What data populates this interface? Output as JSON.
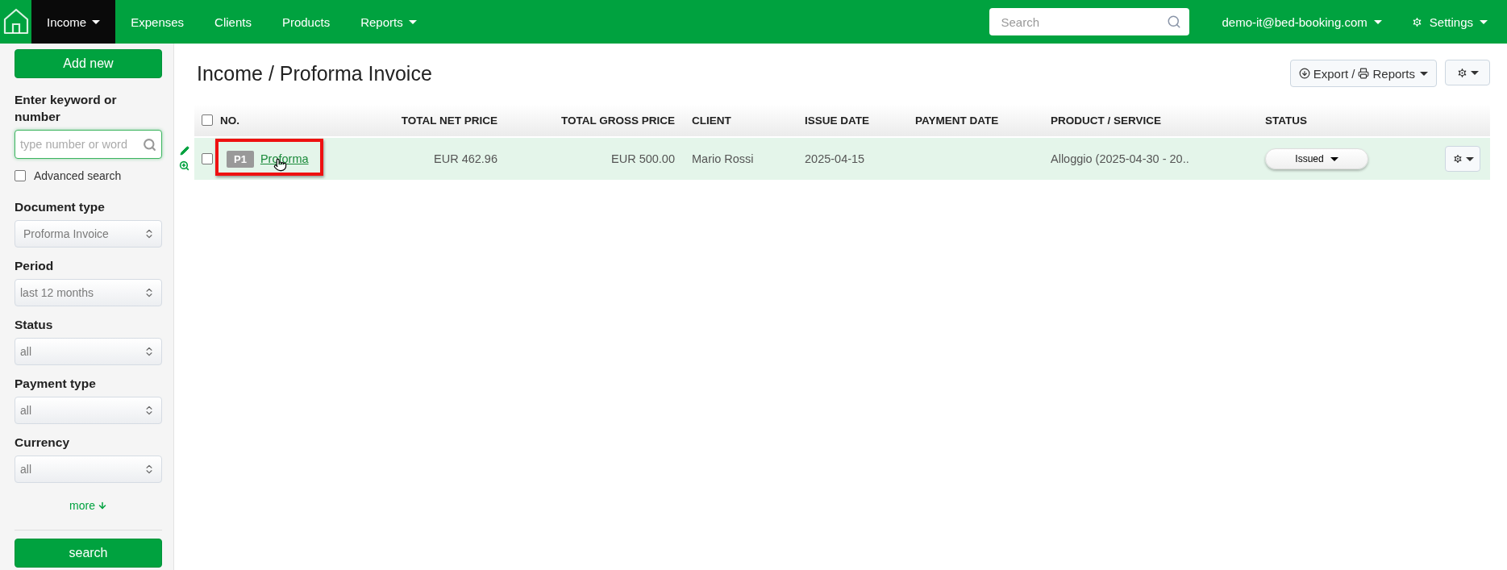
{
  "nav": {
    "items": [
      {
        "label": "Income",
        "dropdown": true,
        "selected": true
      },
      {
        "label": "Expenses",
        "dropdown": false,
        "selected": false
      },
      {
        "label": "Clients",
        "dropdown": false,
        "selected": false
      },
      {
        "label": "Products",
        "dropdown": false,
        "selected": false
      },
      {
        "label": "Reports",
        "dropdown": true,
        "selected": false
      }
    ],
    "search": {
      "placeholder": "Search"
    },
    "account": "demo-it@bed-booking.com",
    "settings": "Settings"
  },
  "sidebar": {
    "add_button": "Add new",
    "keyword_label": "Enter keyword or number",
    "keyword_placeholder": "type number or word",
    "advanced": {
      "label": "Advanced search",
      "checked": false
    },
    "filters": [
      {
        "label": "Document type",
        "value": "Proforma Invoice"
      },
      {
        "label": "Period",
        "value": "last 12 months"
      },
      {
        "label": "Status",
        "value": "all"
      },
      {
        "label": "Payment type",
        "value": "all"
      },
      {
        "label": "Currency",
        "value": "all"
      }
    ],
    "more": "more",
    "search_button": "search"
  },
  "page": {
    "title": "Income / Proforma Invoice",
    "export_button": {
      "export": "Export",
      "separator": "/",
      "reports": "Reports"
    }
  },
  "table": {
    "columns": [
      "NO.",
      "TOTAL NET PRICE",
      "TOTAL GROSS PRICE",
      "CLIENT",
      "ISSUE DATE",
      "PAYMENT DATE",
      "PRODUCT / SERVICE",
      "STATUS"
    ],
    "rows": [
      {
        "checked": false,
        "badge": "P1",
        "number": "Proforma",
        "highlighted": true,
        "net": "EUR 462.96",
        "gross": "EUR 500.00",
        "client": "Mario Rossi",
        "issue_date": "2025-04-15",
        "payment_date": "",
        "product": "Alloggio (2025-04-30 - 20..",
        "status": "Issued"
      }
    ]
  }
}
